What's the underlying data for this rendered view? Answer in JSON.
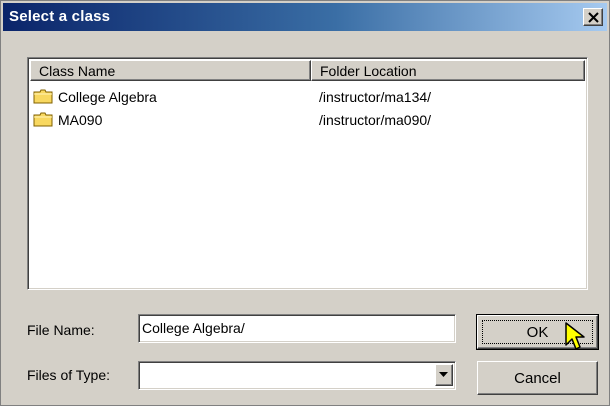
{
  "window": {
    "title": "Select a class"
  },
  "icons": {
    "close": "close-x-icon",
    "folder": "folder-icon",
    "dropdown": "chevron-down-icon",
    "cursor": "pointer-cursor-icon"
  },
  "colors": {
    "titlebar_start": "#0a246a",
    "titlebar_end": "#a6caf0",
    "dialog_face": "#d4d0c8",
    "folder_yellow": "#f8d860"
  },
  "list": {
    "columns": [
      "Class Name",
      "Folder Location"
    ],
    "rows": [
      {
        "name": "College Algebra",
        "location": "/instructor/ma134/"
      },
      {
        "name": "MA090",
        "location": "/instructor/ma090/"
      }
    ]
  },
  "form": {
    "file_name_label": "File Name:",
    "file_name_value": "College Algebra/",
    "files_of_type_label": "Files of Type:",
    "files_of_type_value": ""
  },
  "buttons": {
    "ok": "OK",
    "cancel": "Cancel"
  }
}
